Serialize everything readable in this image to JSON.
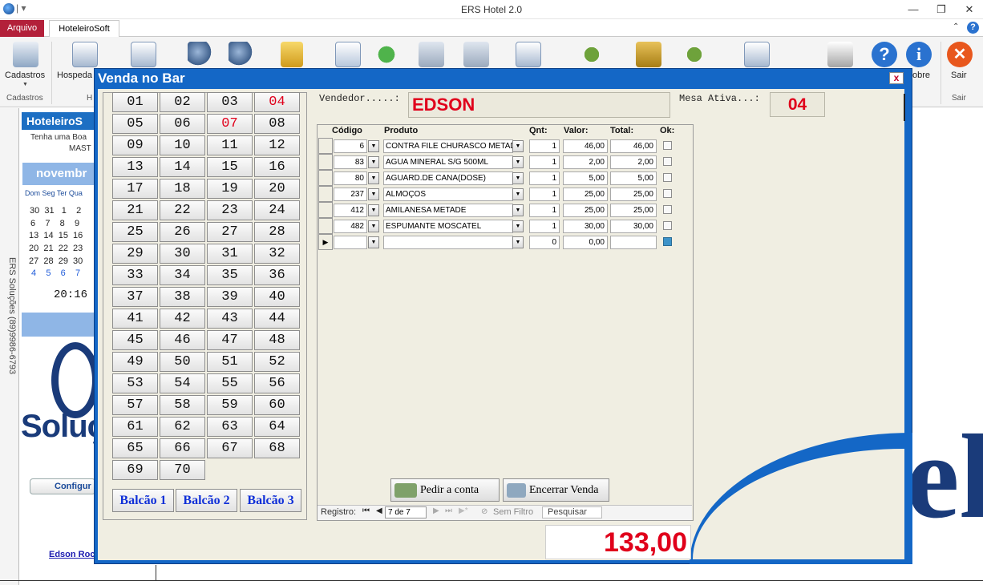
{
  "window": {
    "title": "ERS Hotel 2.0",
    "controls": [
      "minimize",
      "restore",
      "close"
    ]
  },
  "ribbon": {
    "tabs": [
      {
        "label": "Arquivo",
        "active": false
      },
      {
        "label": "HoteleiroSoft",
        "active": true
      }
    ],
    "buttons": [
      {
        "label": "Cadastros",
        "icon": "cadastros-icon"
      },
      {
        "label": "Hospeda",
        "icon": "hospedagem-icon"
      },
      {
        "label": "obre",
        "icon": "info-icon"
      },
      {
        "label": "Sair",
        "icon": "exit-icon"
      }
    ],
    "groups": [
      {
        "label": "Cadastros"
      },
      {
        "label": "H"
      },
      {
        "label": "Sair"
      }
    ],
    "help_label": "?"
  },
  "side": {
    "vertical_text": "ERS Soluções (89)9986-6793",
    "header": "HoteleiroS",
    "greeting_line1": "Tenha uma Boa",
    "greeting_line2": "MAST",
    "month": "novembr",
    "weekdays": "Dom Seg Ter Qua",
    "cal_rows": [
      "30  31   1    2",
      "6    7    8    9",
      "13  14  15  16",
      "20  21  22  23",
      "27  28  29  30",
      "4    5    6    7"
    ],
    "clock": "20:16",
    "logo_text": "Soluç",
    "config_label": "Configur",
    "link": "Edson Roc",
    "brand_tail": "el"
  },
  "modal": {
    "title": "Venda no Bar",
    "close": "x",
    "vendedor_label": "Vendedor.....:",
    "vendedor_value": "EDSON",
    "mesa_label": "Mesa Ativa...:",
    "mesa_value": "04",
    "tables": [
      {
        "label": "01",
        "busy": false
      },
      {
        "label": "02",
        "busy": false
      },
      {
        "label": "03",
        "busy": false
      },
      {
        "label": "04",
        "busy": true
      },
      {
        "label": "05",
        "busy": false
      },
      {
        "label": "06",
        "busy": false
      },
      {
        "label": "07",
        "busy": true
      },
      {
        "label": "08",
        "busy": false
      },
      {
        "label": "09",
        "busy": false
      },
      {
        "label": "10",
        "busy": false
      },
      {
        "label": "11",
        "busy": false
      },
      {
        "label": "12",
        "busy": false
      },
      {
        "label": "13",
        "busy": false
      },
      {
        "label": "14",
        "busy": false
      },
      {
        "label": "15",
        "busy": false
      },
      {
        "label": "16",
        "busy": false
      },
      {
        "label": "17",
        "busy": false
      },
      {
        "label": "18",
        "busy": false
      },
      {
        "label": "19",
        "busy": false
      },
      {
        "label": "20",
        "busy": false
      },
      {
        "label": "21",
        "busy": false
      },
      {
        "label": "22",
        "busy": false
      },
      {
        "label": "23",
        "busy": false
      },
      {
        "label": "24",
        "busy": false
      },
      {
        "label": "25",
        "busy": false
      },
      {
        "label": "26",
        "busy": false
      },
      {
        "label": "27",
        "busy": false
      },
      {
        "label": "28",
        "busy": false
      },
      {
        "label": "29",
        "busy": false
      },
      {
        "label": "30",
        "busy": false
      },
      {
        "label": "31",
        "busy": false
      },
      {
        "label": "32",
        "busy": false
      },
      {
        "label": "33",
        "busy": false
      },
      {
        "label": "34",
        "busy": false
      },
      {
        "label": "35",
        "busy": false
      },
      {
        "label": "36",
        "busy": false
      },
      {
        "label": "37",
        "busy": false
      },
      {
        "label": "38",
        "busy": false
      },
      {
        "label": "39",
        "busy": false
      },
      {
        "label": "40",
        "busy": false
      },
      {
        "label": "41",
        "busy": false
      },
      {
        "label": "42",
        "busy": false
      },
      {
        "label": "43",
        "busy": false
      },
      {
        "label": "44",
        "busy": false
      },
      {
        "label": "45",
        "busy": false
      },
      {
        "label": "46",
        "busy": false
      },
      {
        "label": "47",
        "busy": false
      },
      {
        "label": "48",
        "busy": false
      },
      {
        "label": "49",
        "busy": false
      },
      {
        "label": "50",
        "busy": false
      },
      {
        "label": "51",
        "busy": false
      },
      {
        "label": "52",
        "busy": false
      },
      {
        "label": "53",
        "busy": false
      },
      {
        "label": "54",
        "busy": false
      },
      {
        "label": "55",
        "busy": false
      },
      {
        "label": "56",
        "busy": false
      },
      {
        "label": "57",
        "busy": false
      },
      {
        "label": "58",
        "busy": false
      },
      {
        "label": "59",
        "busy": false
      },
      {
        "label": "60",
        "busy": false
      },
      {
        "label": "61",
        "busy": false
      },
      {
        "label": "62",
        "busy": false
      },
      {
        "label": "63",
        "busy": false
      },
      {
        "label": "64",
        "busy": false
      },
      {
        "label": "65",
        "busy": false
      },
      {
        "label": "66",
        "busy": false
      },
      {
        "label": "67",
        "busy": false
      },
      {
        "label": "68",
        "busy": false
      },
      {
        "label": "69",
        "busy": false
      },
      {
        "label": "70",
        "busy": false
      }
    ],
    "balcoes": [
      "Balcão 1",
      "Balcão 2",
      "Balcão 3"
    ],
    "grid": {
      "headers": {
        "codigo": "Código",
        "produto": "Produto",
        "qnt": "Qnt:",
        "valor": "Valor:",
        "total": "Total:",
        "ok": "Ok:"
      },
      "rows": [
        {
          "codigo": "6",
          "produto": "CONTRA FILE CHURASCO METADE",
          "qnt": "1",
          "valor": "46,00",
          "total": "46,00",
          "ok": false
        },
        {
          "codigo": "83",
          "produto": "AGUA MINERAL S/G 500ML",
          "qnt": "1",
          "valor": "2,00",
          "total": "2,00",
          "ok": false
        },
        {
          "codigo": "80",
          "produto": "AGUARD.DE CANA(DOSE)",
          "qnt": "1",
          "valor": "5,00",
          "total": "5,00",
          "ok": false
        },
        {
          "codigo": "237",
          "produto": "ALMOÇOS",
          "qnt": "1",
          "valor": "25,00",
          "total": "25,00",
          "ok": false
        },
        {
          "codigo": "412",
          "produto": "AMILANESA METADE",
          "qnt": "1",
          "valor": "25,00",
          "total": "25,00",
          "ok": false
        },
        {
          "codigo": "482",
          "produto": "ESPUMANTE MOSCATEL",
          "qnt": "1",
          "valor": "30,00",
          "total": "30,00",
          "ok": false
        },
        {
          "codigo": "",
          "produto": "",
          "qnt": "0",
          "valor": "0,00",
          "total": "",
          "ok": true
        }
      ]
    },
    "btn_pedir": "Pedir a conta",
    "btn_encerrar": "Encerrar Venda",
    "nav": {
      "registro_label": "Registro:",
      "current": "7 de 7",
      "filter": "Sem Filtro",
      "search": "Pesquisar"
    },
    "total": "133,00"
  }
}
